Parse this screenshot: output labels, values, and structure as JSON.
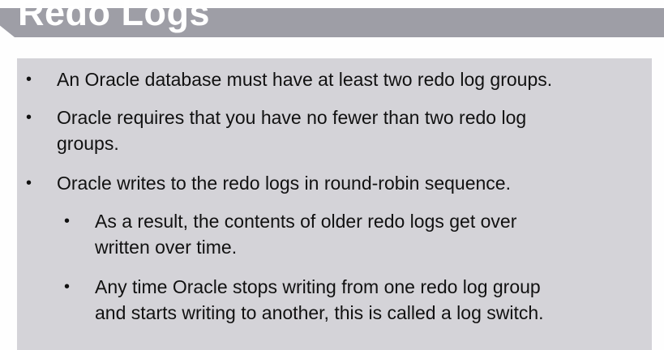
{
  "title": "Redo Logs",
  "bullets": [
    {
      "lines": [
        "An Oracle database must have at least two redo log groups."
      ]
    },
    {
      "lines": [
        "Oracle requires that you have no fewer than two redo log",
        "groups."
      ]
    },
    {
      "lines": [
        "Oracle writes to the redo logs in round-robin sequence."
      ]
    }
  ],
  "sub_bullets": [
    {
      "lines": [
        "As a result, the contents of older redo logs get over",
        "written over time."
      ]
    },
    {
      "lines": [
        "Any time Oracle stops writing from one redo log group",
        "and starts writing to another, this is called a log switch."
      ]
    }
  ],
  "bullet_glyph": "•"
}
